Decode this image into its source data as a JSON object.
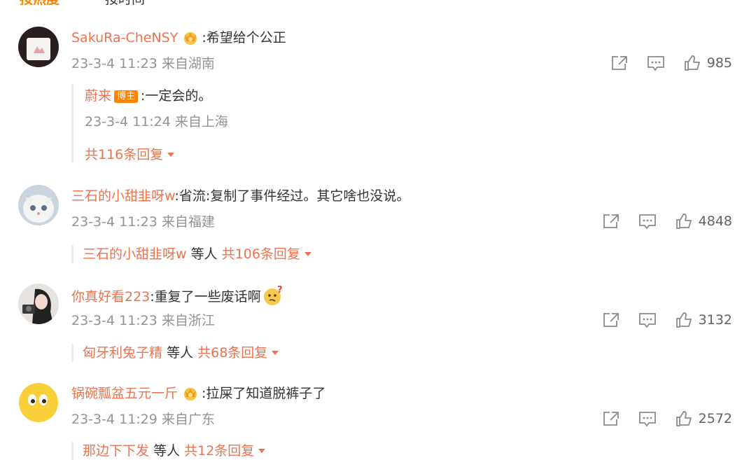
{
  "tabs": {
    "active": "按热度",
    "inactive": "按时间"
  },
  "comments": [
    {
      "username": "SakuRa-CheNSY",
      "text": ":希望给个公正",
      "meta": "23-3-4 11:23 来自湖南",
      "likes": "985",
      "reply": {
        "username": "蔚来",
        "badge": "博主",
        "text": ":一定会的。",
        "meta": "23-3-4 11:24 来自上海",
        "more": "共116条回复"
      }
    },
    {
      "username": "三石的小甜韭呀w",
      "text": ":省流:复制了事件经过。其它啥也没说。",
      "meta": "23-3-4 11:23 来自福建",
      "likes": "4848",
      "summary": {
        "user": "三石的小甜韭呀w",
        "others": "等人",
        "count": "共106条回复"
      }
    },
    {
      "username": "你真好看223",
      "text": ":重复了一些废话啊",
      "meta": "23-3-4 11:23 来自浙江",
      "likes": "3132",
      "summary": {
        "user": "匈牙利兔子精",
        "others": "等人",
        "count": "共68条回复"
      }
    },
    {
      "username": "锅碗瓢盆五元一斤",
      "text": ":拉屎了知道脱裤子了",
      "meta": "23-3-4 11:29 来自广东",
      "likes": "2572",
      "summary": {
        "user": "那边下下发",
        "others": "等人",
        "count": "共12条回复"
      }
    }
  ],
  "colors": {
    "accent": "#ff8200",
    "username": "#eb7350",
    "meta": "#939393",
    "text": "#333333"
  },
  "icons": [
    "forward-icon",
    "comment-icon",
    "like-icon",
    "crown-icon",
    "thinking-emoji-icon",
    "caret-down-icon"
  ]
}
